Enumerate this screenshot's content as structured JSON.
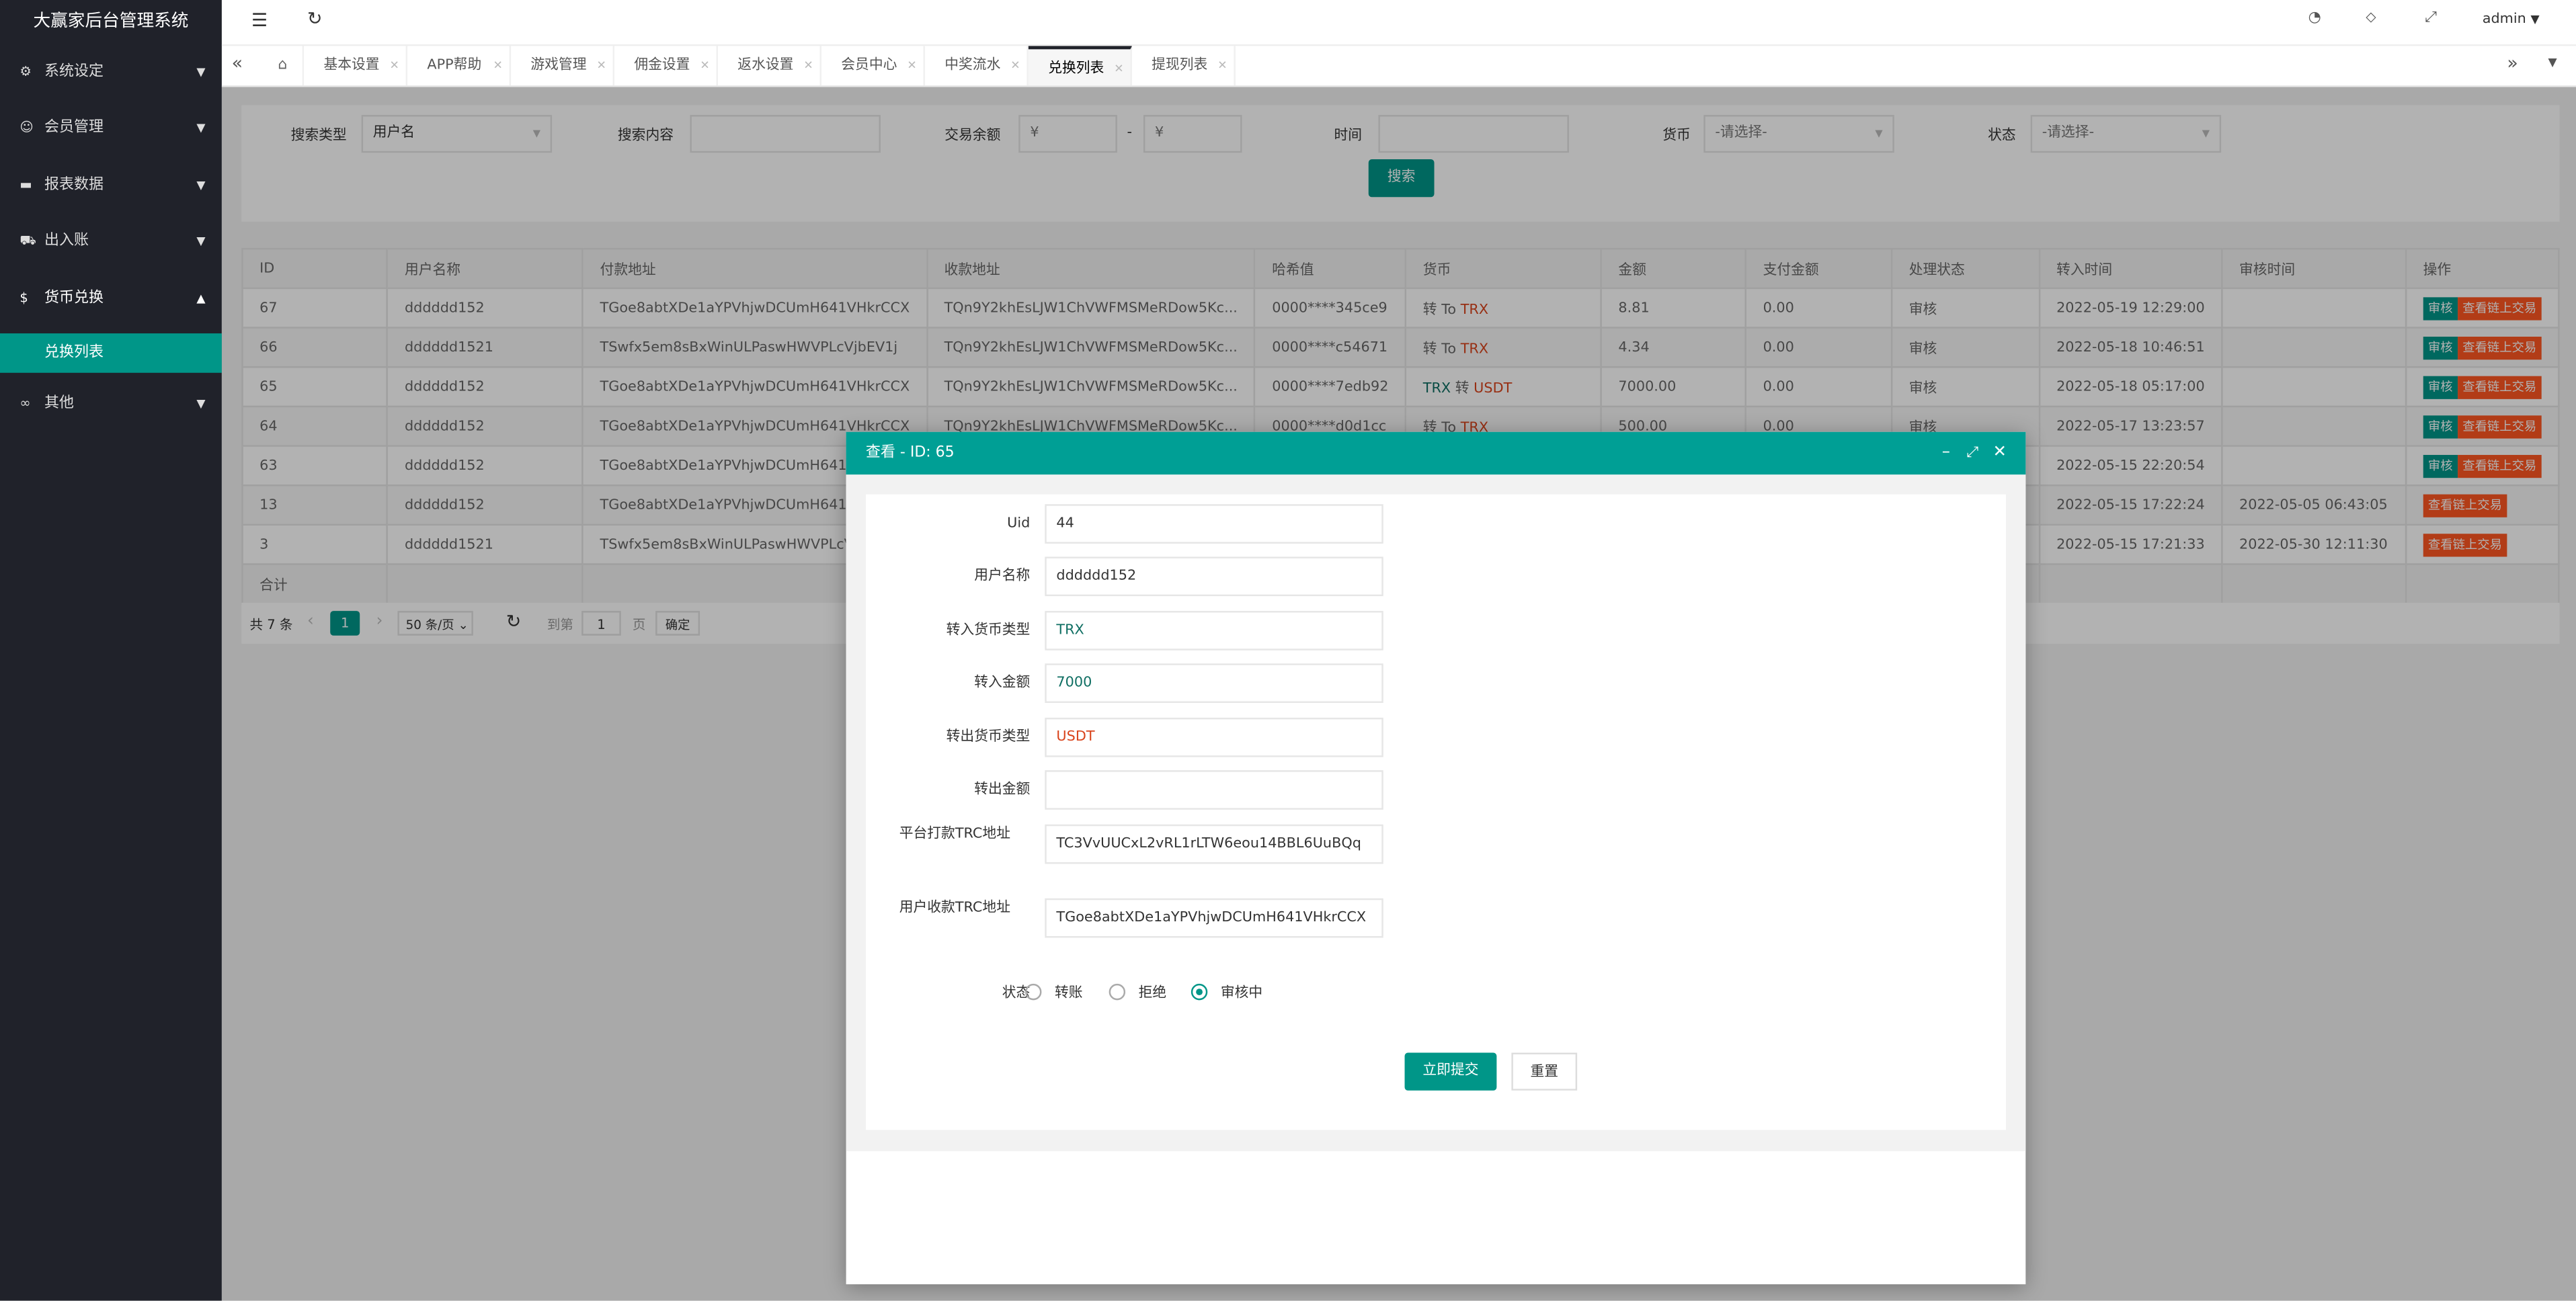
{
  "app_title": "大赢家后台管理系统",
  "sidebar": {
    "items": [
      {
        "label": "系统设定",
        "icon": "gear-icon",
        "glyph": "⚙"
      },
      {
        "label": "会员管理",
        "icon": "user-icon",
        "glyph": "☺"
      },
      {
        "label": "报表数据",
        "icon": "chat-icon",
        "glyph": "▬"
      },
      {
        "label": "出入账",
        "icon": "car-icon",
        "glyph": "⛟"
      },
      {
        "label": "货币兑换",
        "icon": "dollar-icon",
        "glyph": "$"
      },
      {
        "label": "其他",
        "icon": "link-icon",
        "glyph": "∞"
      }
    ],
    "sub_item": "兑换列表"
  },
  "header": {
    "user": "admin"
  },
  "tabs": [
    "基本设置",
    "APP帮助",
    "游戏管理",
    "佣金设置",
    "返水设置",
    "会员中心",
    "中奖流水",
    "兑换列表",
    "提现列表"
  ],
  "active_tab": "兑换列表",
  "filters": {
    "search_type_label": "搜索类型",
    "search_type_value": "用户名",
    "search_content_label": "搜索内容",
    "balance_label": "交易余额",
    "currency_symbol": "¥",
    "dash": "-",
    "time_label": "时间",
    "currency_label": "货币",
    "currency_placeholder": "-请选择-",
    "status_label": "状态",
    "status_placeholder": "-请选择-",
    "search_button": "搜索"
  },
  "table": {
    "headers": [
      "ID",
      "用户名称",
      "付款地址",
      "收款地址",
      "哈希值",
      "货币",
      "金额",
      "支付金额",
      "处理状态",
      "转入时间",
      "审核时间",
      "操作"
    ],
    "rows": [
      {
        "id": "67",
        "user": "dddddd152",
        "pay": "TGoe8abtXDe1aYPVhjwDCUmH641VHkrCCX",
        "recv": "TQn9Y2khEsLJW1ChVWFMSMeRDow5Kc...",
        "hash": "0000****345ce9",
        "from": "转",
        "mid": "To",
        "to": "TRX",
        "amount": "8.81",
        "paid": "0.00",
        "status": "审核",
        "in_time": "2022-05-19 12:29:00",
        "audit_time": "",
        "audit": true
      },
      {
        "id": "66",
        "user": "dddddd1521",
        "pay": "TSwfx5em8sBxWinULPaswHWVPLcVjbEV1j",
        "recv": "TQn9Y2khEsLJW1ChVWFMSMeRDow5Kc...",
        "hash": "0000****c54671",
        "from": "转",
        "mid": "To",
        "to": "TRX",
        "amount": "4.34",
        "paid": "0.00",
        "status": "审核",
        "in_time": "2022-05-18 10:46:51",
        "audit_time": "",
        "audit": true
      },
      {
        "id": "65",
        "user": "dddddd152",
        "pay": "TGoe8abtXDe1aYPVhjwDCUmH641VHkrCCX",
        "recv": "TQn9Y2khEsLJW1ChVWFMSMeRDow5Kc...",
        "hash": "0000****7edb92",
        "from": "TRX",
        "mid": "转",
        "to": "USDT",
        "amount": "7000.00",
        "paid": "0.00",
        "status": "审核",
        "in_time": "2022-05-18 05:17:00",
        "audit_time": "",
        "audit": true
      },
      {
        "id": "64",
        "user": "dddddd152",
        "pay": "TGoe8abtXDe1aYPVhjwDCUmH641VHkrCCX",
        "recv": "TQn9Y2khEsLJW1ChVWFMSMeRDow5Kc...",
        "hash": "0000****d0d1cc",
        "from": "转",
        "mid": "To",
        "to": "TRX",
        "amount": "500.00",
        "paid": "0.00",
        "status": "审核",
        "in_time": "2022-05-17 13:23:57",
        "audit_time": "",
        "audit": true
      },
      {
        "id": "63",
        "user": "dddddd152",
        "pay": "TGoe8abtXDe1aYPVhjwDCUmH641VHkrCCX",
        "recv": "",
        "hash": "",
        "from": "",
        "mid": "",
        "to": "",
        "amount": "",
        "paid": "",
        "status": "",
        "in_time": "2022-05-15 22:20:54",
        "audit_time": "",
        "audit": true
      },
      {
        "id": "13",
        "user": "dddddd152",
        "pay": "TGoe8abtXDe1aYPVhjwDCUmH641VHkrCCX",
        "recv": "",
        "hash": "",
        "from": "",
        "mid": "",
        "to": "",
        "amount": "",
        "paid": "",
        "status": "",
        "in_time": "2022-05-15 17:22:24",
        "audit_time": "2022-05-05 06:43:05",
        "audit": false
      },
      {
        "id": "3",
        "user": "dddddd1521",
        "pay": "TSwfx5em8sBxWinULPaswHWVPLcVjbEV1j",
        "recv": "",
        "hash": "",
        "from": "",
        "mid": "",
        "to": "",
        "amount": "",
        "paid": "",
        "status": "",
        "in_time": "2022-05-15 17:21:33",
        "audit_time": "2022-05-30 12:11:30",
        "audit": false
      }
    ],
    "total_label": "合计",
    "audit_btn": "审核",
    "chain_btn": "查看链上交易"
  },
  "pager": {
    "total": "共 7 条",
    "page": "1",
    "per_page": "50 条/页",
    "goto": "到第",
    "goto_value": "1",
    "page_unit": "页",
    "confirm": "确定"
  },
  "modal": {
    "title": "查看 - ID: 65",
    "fields": [
      {
        "label": "Uid",
        "value": "44"
      },
      {
        "label": "用户名称",
        "value": "dddddd152"
      },
      {
        "label": "转入货币类型",
        "value": "TRX",
        "color": "teal"
      },
      {
        "label": "转入金额",
        "value": "7000",
        "color": "teal"
      },
      {
        "label": "转出货币类型",
        "value": "USDT",
        "color": "red"
      },
      {
        "label": "转出金额",
        "value": ""
      },
      {
        "label": "平台打款TRC地址",
        "value": "TC3VvUUCxL2vRL1rLTW6eou14BBL6UuBQq"
      },
      {
        "label": "用户收款TRC地址",
        "value": "TGoe8abtXDe1aYPVhjwDCUmH641VHkrCCX"
      }
    ],
    "status_label": "状态",
    "status_options": [
      "转账",
      "拒绝",
      "审核中"
    ],
    "status_selected": "审核中",
    "submit": "立即提交",
    "reset": "重置"
  },
  "colors": {
    "primary": "#009688",
    "danger": "#ff5722",
    "sidebar": "#20222a"
  }
}
